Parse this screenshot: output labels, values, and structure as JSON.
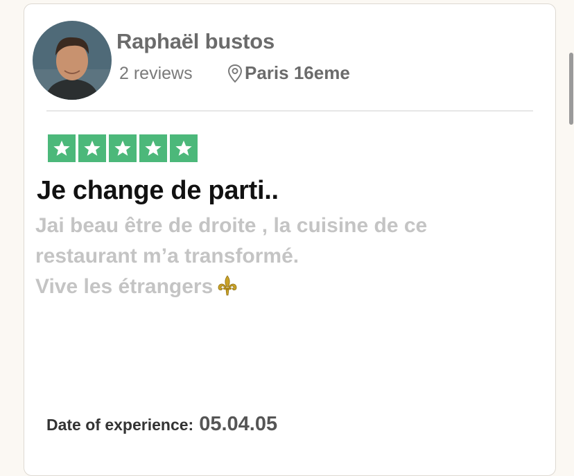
{
  "reviewer": {
    "name": "Raphaël bustos",
    "reviews_count": "2 reviews",
    "location": "Paris 16eme"
  },
  "rating": {
    "stars": 5,
    "max": 5,
    "color": "#4cb87a"
  },
  "review": {
    "title": "Je change de parti..",
    "body_lines": [
      "Jai beau être de droite , la cuisine de ce",
      "restaurant m’a transformé.",
      "Vive les étrangers"
    ]
  },
  "experience": {
    "label": "Date of experience:",
    "date": "05.04.05"
  },
  "icons": [
    "location-pin-icon",
    "star-icon",
    "fleur-de-lis-emoji"
  ]
}
